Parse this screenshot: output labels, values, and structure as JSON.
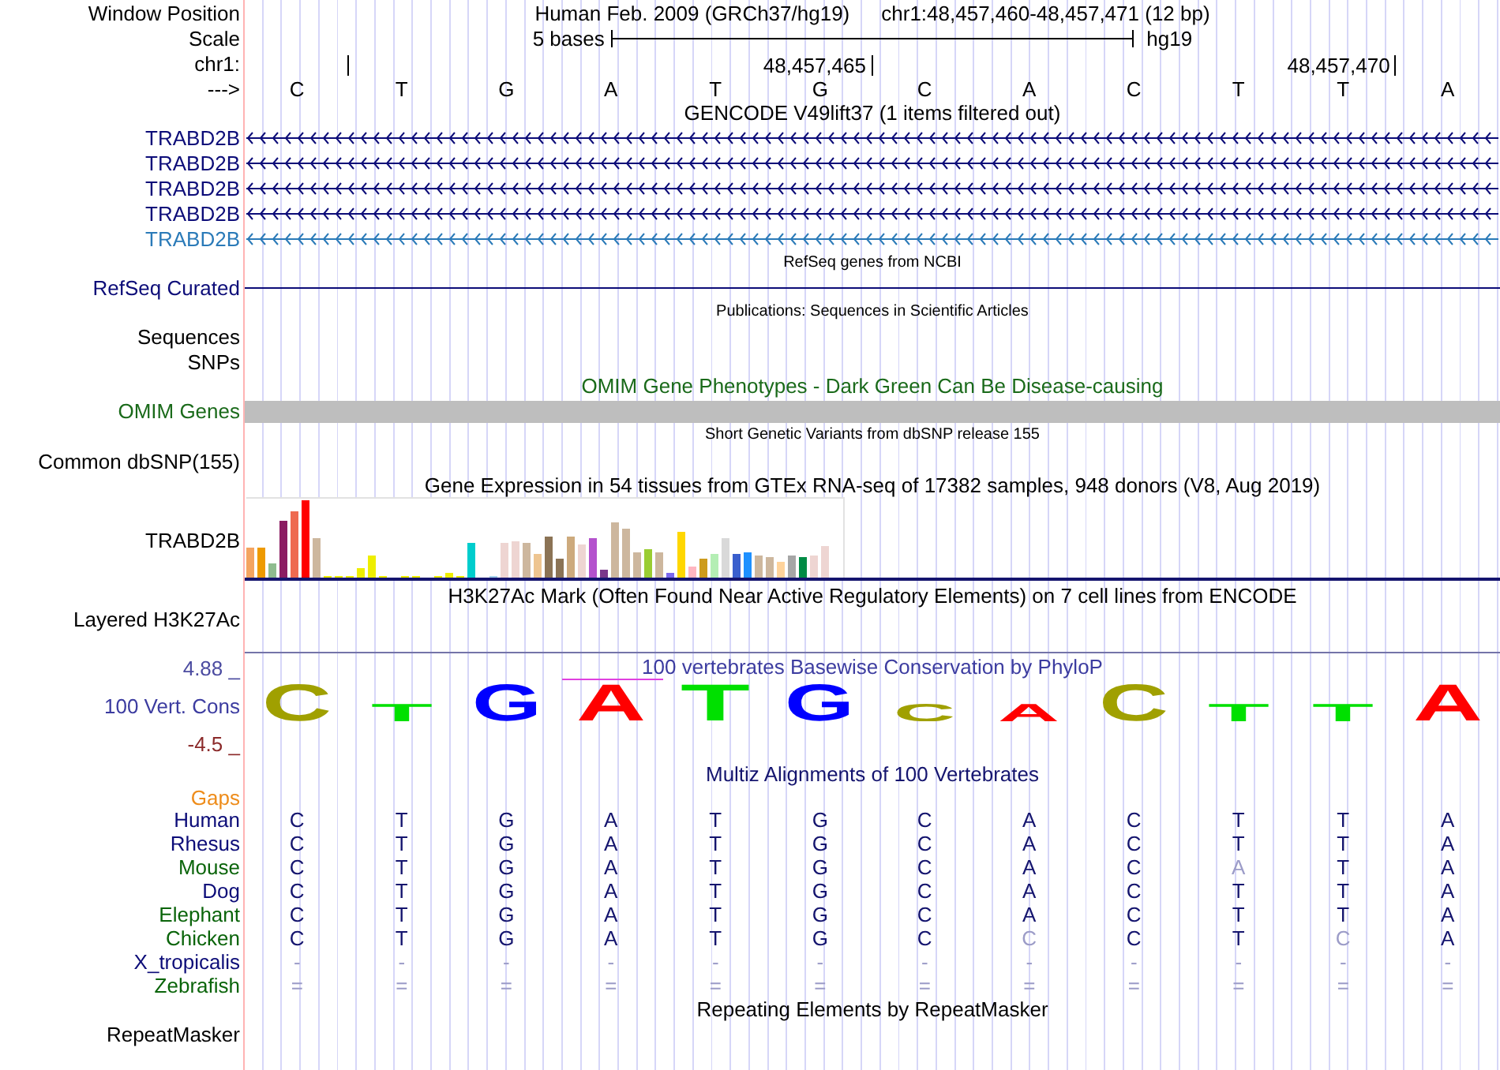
{
  "header": {
    "window_position": {
      "label": "Window Position",
      "assembly": "Human Feb. 2009 (GRCh37/hg19)",
      "region": "chr1:48,457,460-48,457,471 (12 bp)"
    },
    "scale": {
      "label": "Scale",
      "span": "5 bases",
      "assembly": "hg19"
    },
    "ruler": {
      "label": "chr1:",
      "ticks": [
        "48,457,465",
        "48,457,470"
      ]
    },
    "sequence": {
      "label": "--->",
      "bases": [
        "C",
        "T",
        "G",
        "A",
        "T",
        "G",
        "C",
        "A",
        "C",
        "T",
        "T",
        "A"
      ]
    }
  },
  "tracks": [
    {
      "kind": "genes",
      "title": "GENCODE V49lift37 (1 items filtered out)",
      "items": [
        {
          "label": "TRABD2B",
          "color": "#0c0c78"
        },
        {
          "label": "TRABD2B",
          "color": "#0c0c78"
        },
        {
          "label": "TRABD2B",
          "color": "#0c0c78"
        },
        {
          "label": "TRABD2B",
          "color": "#0c0c78"
        },
        {
          "label": "TRABD2B",
          "color": "#2a7ab8"
        }
      ]
    },
    {
      "kind": "curated",
      "title": "RefSeq genes from NCBI",
      "label": "RefSeq Curated"
    },
    {
      "kind": "publications",
      "title": "Publications: Sequences in Scientific Articles",
      "labels": [
        "Sequences",
        "SNPs"
      ]
    },
    {
      "kind": "phenotypes",
      "title": "OMIM Gene Phenotypes - Dark Green Can Be Disease-causing",
      "label": "OMIM Genes"
    },
    {
      "kind": "variants",
      "title": "Short Genetic Variants from dbSNP release 155",
      "labels": [
        "Common dbSNP(155)"
      ]
    },
    {
      "kind": "expression",
      "title": "Gene Expression in 54 tissues from GTEx RNA-seq of 17382 samples, 948 donors (V8, Aug 2019)",
      "label": "TRABD2B"
    },
    {
      "kind": "signal",
      "title": "H3K27Ac Mark (Often Found Near Active Regulatory Elements) on 7 cell lines from ENCODE",
      "label": "Layered H3K27Ac"
    },
    {
      "kind": "conservation",
      "title": "100 vertebrates Basewise Conservation by PhyloP",
      "label": "100 Vert. Cons",
      "axis_max": "4.88 _",
      "axis_min": "-4.5 _",
      "letters": [
        {
          "base": "C",
          "color": "#a0a000",
          "conserved": true
        },
        {
          "base": "T",
          "color": "#00e000",
          "conserved": false
        },
        {
          "base": "G",
          "color": "#0000ff",
          "conserved": true
        },
        {
          "base": "A",
          "color": "#ff0000",
          "conserved": true
        },
        {
          "base": "T",
          "color": "#00e000",
          "conserved": true
        },
        {
          "base": "G",
          "color": "#0000ff",
          "conserved": true
        },
        {
          "base": "C",
          "color": "#a0a000",
          "conserved": false
        },
        {
          "base": "A",
          "color": "#ff0000",
          "conserved": false
        },
        {
          "base": "C",
          "color": "#a0a000",
          "conserved": true
        },
        {
          "base": "T",
          "color": "#00e000",
          "conserved": false
        },
        {
          "base": "T",
          "color": "#00e000",
          "conserved": false
        },
        {
          "base": "A",
          "color": "#ff0000",
          "conserved": true
        }
      ]
    },
    {
      "kind": "alignment",
      "title": "Multiz Alignments of 100 Vertebrates",
      "gaps_label": "Gaps",
      "species": [
        {
          "name": "Human",
          "color": "#0c0c78",
          "bases": [
            {
              "base": "C",
              "faded": false
            },
            {
              "base": "T",
              "faded": false
            },
            {
              "base": "G",
              "faded": false
            },
            {
              "base": "A",
              "faded": false
            },
            {
              "base": "T",
              "faded": false
            },
            {
              "base": "G",
              "faded": false
            },
            {
              "base": "C",
              "faded": false
            },
            {
              "base": "A",
              "faded": false
            },
            {
              "base": "C",
              "faded": false
            },
            {
              "base": "T",
              "faded": false
            },
            {
              "base": "T",
              "faded": false
            },
            {
              "base": "A",
              "faded": false
            }
          ]
        },
        {
          "name": "Rhesus",
          "color": "#0c0c78",
          "bases": [
            {
              "base": "C",
              "faded": false
            },
            {
              "base": "T",
              "faded": false
            },
            {
              "base": "G",
              "faded": false
            },
            {
              "base": "A",
              "faded": false
            },
            {
              "base": "T",
              "faded": false
            },
            {
              "base": "G",
              "faded": false
            },
            {
              "base": "C",
              "faded": false
            },
            {
              "base": "A",
              "faded": false
            },
            {
              "base": "C",
              "faded": false
            },
            {
              "base": "T",
              "faded": false
            },
            {
              "base": "T",
              "faded": false
            },
            {
              "base": "A",
              "faded": false
            }
          ]
        },
        {
          "name": "Mouse",
          "color": "#0a640a",
          "bases": [
            {
              "base": "C",
              "faded": false
            },
            {
              "base": "T",
              "faded": false
            },
            {
              "base": "G",
              "faded": false
            },
            {
              "base": "A",
              "faded": false
            },
            {
              "base": "T",
              "faded": false
            },
            {
              "base": "G",
              "faded": false
            },
            {
              "base": "C",
              "faded": false
            },
            {
              "base": "A",
              "faded": false
            },
            {
              "base": "C",
              "faded": false
            },
            {
              "base": "A",
              "faded": true
            },
            {
              "base": "T",
              "faded": false
            },
            {
              "base": "A",
              "faded": false
            }
          ]
        },
        {
          "name": "Dog",
          "color": "#0c0c78",
          "bases": [
            {
              "base": "C",
              "faded": false
            },
            {
              "base": "T",
              "faded": false
            },
            {
              "base": "G",
              "faded": false
            },
            {
              "base": "A",
              "faded": false
            },
            {
              "base": "T",
              "faded": false
            },
            {
              "base": "G",
              "faded": false
            },
            {
              "base": "C",
              "faded": false
            },
            {
              "base": "A",
              "faded": false
            },
            {
              "base": "C",
              "faded": false
            },
            {
              "base": "T",
              "faded": false
            },
            {
              "base": "T",
              "faded": false
            },
            {
              "base": "A",
              "faded": false
            }
          ]
        },
        {
          "name": "Elephant",
          "color": "#0a640a",
          "bases": [
            {
              "base": "C",
              "faded": false
            },
            {
              "base": "T",
              "faded": false
            },
            {
              "base": "G",
              "faded": false
            },
            {
              "base": "A",
              "faded": false
            },
            {
              "base": "T",
              "faded": false
            },
            {
              "base": "G",
              "faded": false
            },
            {
              "base": "C",
              "faded": false
            },
            {
              "base": "A",
              "faded": false
            },
            {
              "base": "C",
              "faded": false
            },
            {
              "base": "T",
              "faded": false
            },
            {
              "base": "T",
              "faded": false
            },
            {
              "base": "A",
              "faded": false
            }
          ]
        },
        {
          "name": "Chicken",
          "color": "#0a640a",
          "bases": [
            {
              "base": "C",
              "faded": false
            },
            {
              "base": "T",
              "faded": false
            },
            {
              "base": "G",
              "faded": false
            },
            {
              "base": "A",
              "faded": false
            },
            {
              "base": "T",
              "faded": false
            },
            {
              "base": "G",
              "faded": false
            },
            {
              "base": "C",
              "faded": false
            },
            {
              "base": "C",
              "faded": true
            },
            {
              "base": "C",
              "faded": false
            },
            {
              "base": "T",
              "faded": false
            },
            {
              "base": "C",
              "faded": true
            },
            {
              "base": "A",
              "faded": false
            }
          ]
        },
        {
          "name": "X_tropicalis",
          "color": "#0c0c78",
          "bases": [
            {
              "base": "-",
              "faded": true
            },
            {
              "base": "-",
              "faded": true
            },
            {
              "base": "-",
              "faded": true
            },
            {
              "base": "-",
              "faded": true
            },
            {
              "base": "-",
              "faded": true
            },
            {
              "base": "-",
              "faded": true
            },
            {
              "base": "-",
              "faded": true
            },
            {
              "base": "-",
              "faded": true
            },
            {
              "base": "-",
              "faded": true
            },
            {
              "base": "-",
              "faded": true
            },
            {
              "base": "-",
              "faded": true
            },
            {
              "base": "-",
              "faded": true
            }
          ]
        },
        {
          "name": "Zebrafish",
          "color": "#0a640a",
          "bases": [
            {
              "base": "=",
              "faded": true
            },
            {
              "base": "=",
              "faded": true
            },
            {
              "base": "=",
              "faded": true
            },
            {
              "base": "=",
              "faded": true
            },
            {
              "base": "=",
              "faded": true
            },
            {
              "base": "=",
              "faded": true
            },
            {
              "base": "=",
              "faded": true
            },
            {
              "base": "=",
              "faded": true
            },
            {
              "base": "=",
              "faded": true
            },
            {
              "base": "=",
              "faded": true
            },
            {
              "base": "=",
              "faded": true
            },
            {
              "base": "=",
              "faded": true
            }
          ]
        }
      ]
    },
    {
      "kind": "repeats",
      "title": "Repeating Elements by RepeatMasker",
      "labels": [
        "RepeatMasker"
      ]
    }
  ]
}
